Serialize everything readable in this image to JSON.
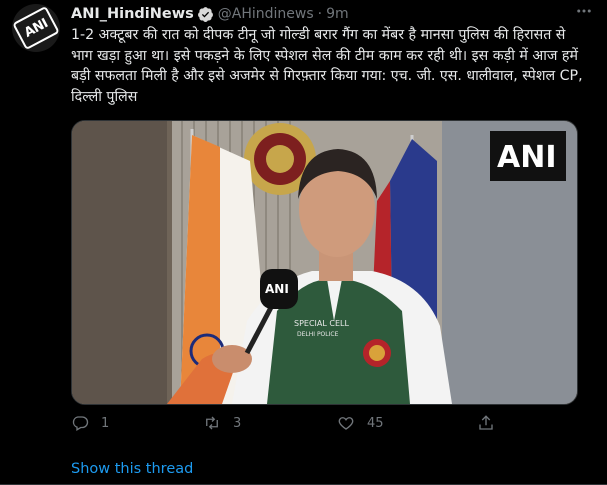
{
  "tweet": {
    "author_name": "ANI_HindiNews",
    "handle": "@AHindinews",
    "separator": "·",
    "time": "9m",
    "text": "1-2 अक्टूबर की रात को दीपक टीनू जो गोल्डी बरार गैंग का मेंबर है मानसा पुलिस की हिरासत से भाग खड़ा हुआ था। इसे पकड़ने के लिए स्पेशल सेल की टीम काम कर रही थी। इस कड़ी में आज हमें बड़ी सफलता मिली है और इसे अजमेर से गिरफ़्तार किया गया: एच. जी. एस. धालीवाल, स्पेशल CP, दिल्ली पुलिस",
    "avatar_text": "ANI",
    "more_icon": "more-dots-icon"
  },
  "media": {
    "watermark": "ANI",
    "mic_label": "ANI",
    "vest_text": "SPECIAL CELL\nDELHI POLICE"
  },
  "actions": {
    "reply_count": "1",
    "retweet_count": "3",
    "like_count": "45"
  },
  "footer": {
    "show_thread": "Show this thread"
  },
  "colors": {
    "background": "#000000",
    "accent": "#1d9bf0",
    "muted": "#71767b",
    "text": "#e7e9ea"
  }
}
